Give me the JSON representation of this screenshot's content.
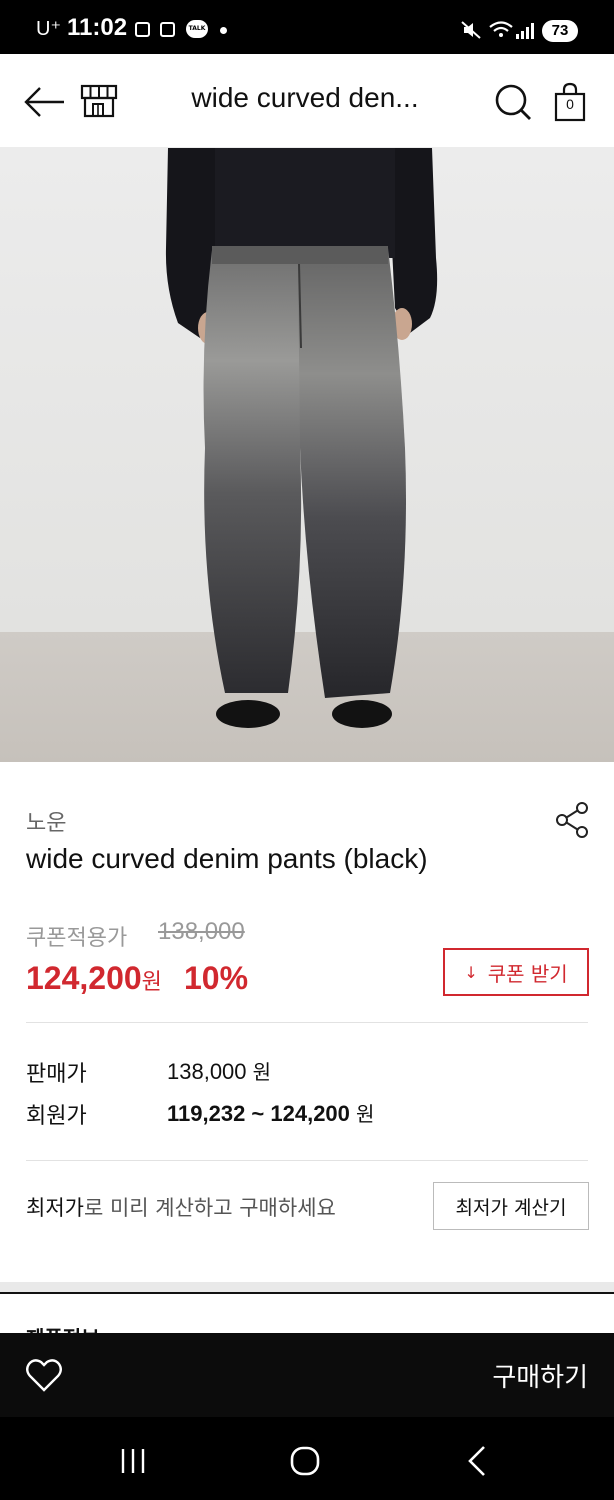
{
  "status_bar": {
    "carrier": "U⁺",
    "time": "11:02",
    "battery": "73",
    "talk_label": "TALK"
  },
  "header": {
    "title": "wide curved den...",
    "cart_count": "0"
  },
  "product": {
    "brand": "노운",
    "name": "wide curved denim pants (black)",
    "coupon_label": "쿠폰적용가",
    "original_price": "138,000",
    "sale_price": "124,200",
    "sale_unit": "원",
    "discount": "10%",
    "coupon_button_label": "쿠폰 받기"
  },
  "pricing_rows": [
    {
      "label": "판매가",
      "value": "138,000",
      "unit": "원"
    },
    {
      "label": "회원가",
      "value": "119,232 ~ 124,200",
      "unit": "원"
    }
  ],
  "calculator": {
    "text_strong": "최저가",
    "text_rest": "로 미리 계산하고 구매하세요",
    "button_label": "최저가 계산기"
  },
  "next_section_label": "제품정보",
  "buy_bar": {
    "buy_label": "구매하기"
  },
  "colors": {
    "accent_red": "#d1282f",
    "bar_black": "#0c0c0c"
  }
}
